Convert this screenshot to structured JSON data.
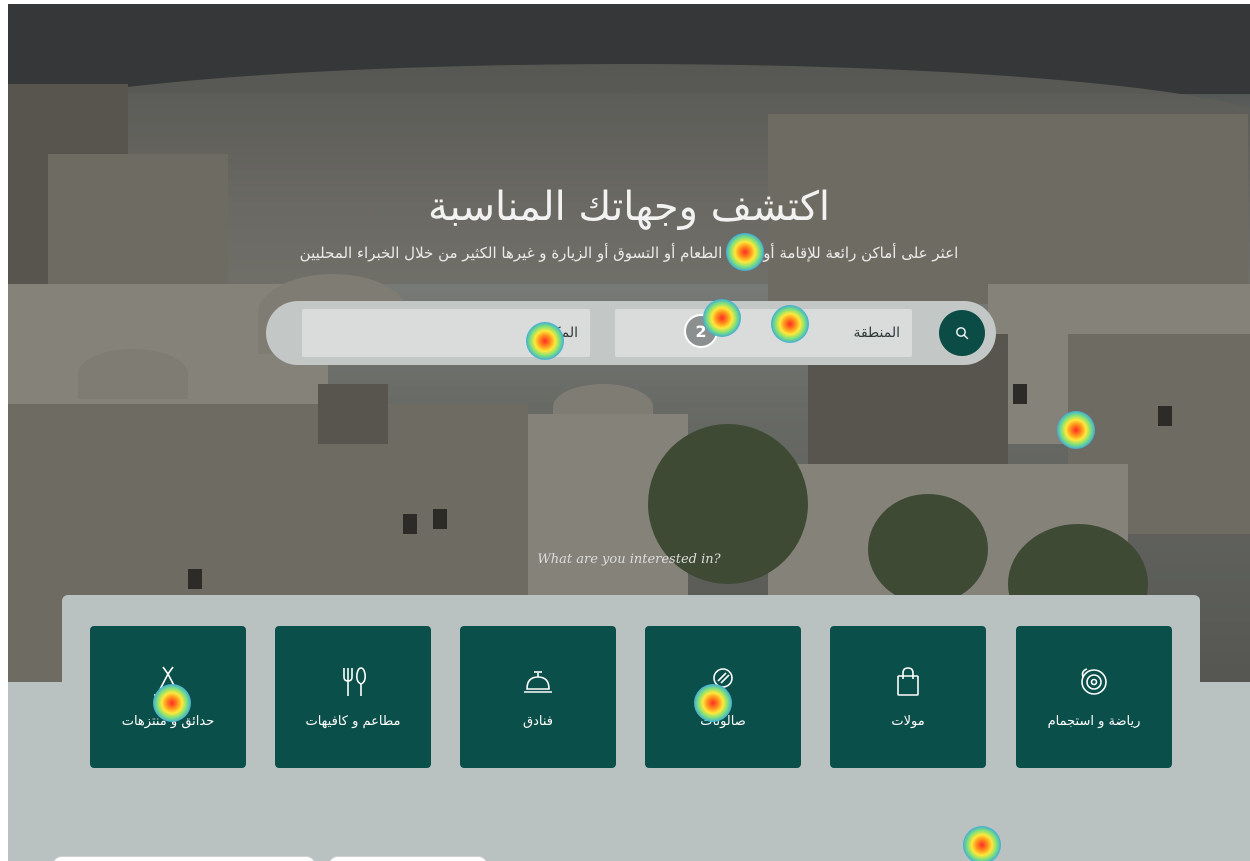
{
  "hero": {
    "title": "اكتشف وجهاتك المناسبة",
    "subtitle": "اعثر على أماكن رائعة للإقامة أو تناول الطعام أو التسوق أو الزيارة و غيرها الكثير من خلال الخبراء المحليين"
  },
  "search": {
    "place_placeholder": "المكان",
    "region_placeholder": "المنطقة",
    "button_icon": "search-icon"
  },
  "step_badge": "2",
  "interest_prompt": "What are you interested in?",
  "categories": [
    {
      "label": "رياضة و استجمام",
      "icon": "disc-brake-icon"
    },
    {
      "label": "مولات",
      "icon": "shopping-bag-icon"
    },
    {
      "label": "صالونات",
      "icon": "hair-dryer-icon"
    },
    {
      "label": "فنادق",
      "icon": "service-bell-icon"
    },
    {
      "label": "مطاعم و كافيهات",
      "icon": "fork-knife-icon"
    },
    {
      "label": "حدائق و منتزهات",
      "icon": "tent-icon"
    }
  ],
  "colors": {
    "primary": "#0b4f4a",
    "panel": "#b9c2c1",
    "search_bar": "#c3c8c6"
  }
}
